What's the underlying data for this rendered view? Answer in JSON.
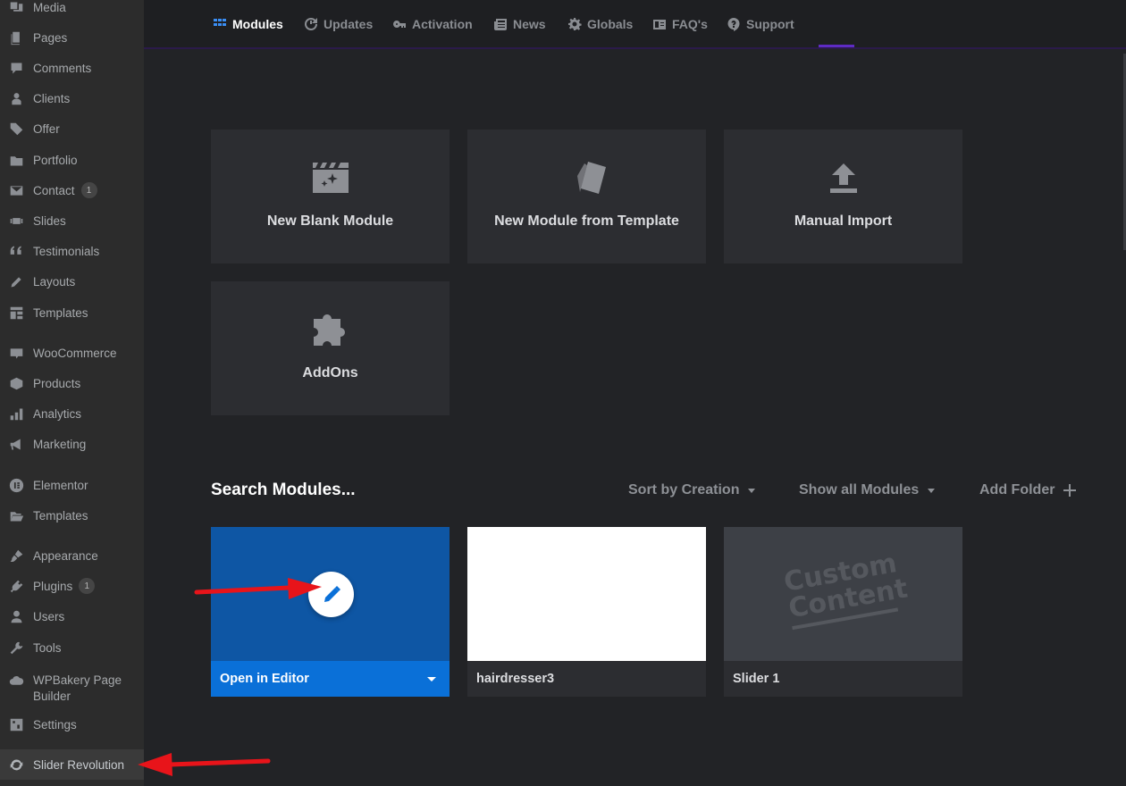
{
  "sidebar": {
    "items": [
      {
        "label": "Media",
        "icon": "media-icon"
      },
      {
        "label": "Pages",
        "icon": "pages-icon"
      },
      {
        "label": "Comments",
        "icon": "comments-icon"
      },
      {
        "label": "Clients",
        "icon": "clients-icon"
      },
      {
        "label": "Offer",
        "icon": "tag-icon"
      },
      {
        "label": "Portfolio",
        "icon": "folder-icon"
      },
      {
        "label": "Contact",
        "icon": "mail-icon",
        "badge": "1"
      },
      {
        "label": "Slides",
        "icon": "slides-icon"
      },
      {
        "label": "Testimonials",
        "icon": "quote-icon"
      },
      {
        "label": "Layouts",
        "icon": "pencil-icon"
      },
      {
        "label": "Templates",
        "icon": "templates-icon"
      },
      {
        "label": "WooCommerce",
        "icon": "woocommerce-icon"
      },
      {
        "label": "Products",
        "icon": "box-icon"
      },
      {
        "label": "Analytics",
        "icon": "bar-chart-icon"
      },
      {
        "label": "Marketing",
        "icon": "megaphone-icon"
      },
      {
        "label": "Elementor",
        "icon": "elementor-icon"
      },
      {
        "label": "Templates",
        "icon": "folder-open-icon"
      },
      {
        "label": "Appearance",
        "icon": "brush-icon"
      },
      {
        "label": "Plugins",
        "icon": "plugin-icon",
        "badge": "1"
      },
      {
        "label": "Users",
        "icon": "user-icon"
      },
      {
        "label": "Tools",
        "icon": "wrench-icon"
      },
      {
        "label": "WPBakery Page Builder",
        "line1": "WPBakery Page",
        "line2": "Builder",
        "icon": "cloud-icon"
      },
      {
        "label": "Settings",
        "icon": "settings-icon"
      },
      {
        "label": "Slider Revolution",
        "icon": "refresh-icon",
        "active": true
      }
    ]
  },
  "nav": {
    "items": [
      {
        "label": "Modules",
        "icon": "grid-icon",
        "active": true
      },
      {
        "label": "Updates",
        "icon": "updates-icon"
      },
      {
        "label": "Activation",
        "icon": "key-icon"
      },
      {
        "label": "News",
        "icon": "news-icon"
      },
      {
        "label": "Globals",
        "icon": "gear-icon"
      },
      {
        "label": "FAQ's",
        "icon": "faq-icon"
      },
      {
        "label": "Support",
        "icon": "support-icon"
      }
    ]
  },
  "actions": {
    "new_blank": "New Blank Module",
    "from_template": "New Module from Template",
    "manual_import": "Manual Import",
    "addons": "AddOns"
  },
  "modules_toolbar": {
    "search": "Search Modules...",
    "sort": "Sort by Creation",
    "filter": "Show all Modules",
    "add_folder": "Add Folder"
  },
  "modules": [
    {
      "name": "Open in Editor",
      "thumb_color": "#0e56a4",
      "footer_color": "#0a70d8"
    },
    {
      "name": "hairdresser3",
      "thumb_color": "#ffffff",
      "footer_color": "#2c2d31"
    },
    {
      "name": "Slider 1",
      "thumb_color": "#3d4046",
      "footer_color": "#2c2d31",
      "thumb_text_line1": "Custom",
      "thumb_text_line2": "Content"
    }
  ],
  "colors": {
    "accent_blue": "#3a8ef5",
    "annotation_red": "#e8141a"
  }
}
